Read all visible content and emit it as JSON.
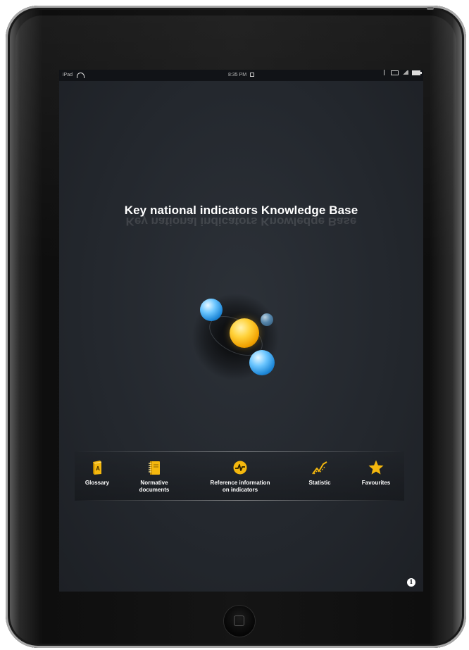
{
  "status_bar": {
    "carrier": "iPad",
    "time": "8:35 PM"
  },
  "app": {
    "title": "Key national indicators Knowledge Base"
  },
  "toolbar": {
    "items": [
      {
        "label": "Glossary",
        "icon": "glossary-book-icon"
      },
      {
        "label": "Normative\ndocuments",
        "icon": "notebook-icon"
      },
      {
        "label": "Reference information\non indicators",
        "icon": "reference-info-icon"
      },
      {
        "label": "Statistic",
        "icon": "statistic-chart-icon"
      },
      {
        "label": "Favourites",
        "icon": "star-icon"
      }
    ]
  },
  "info_button": {
    "glyph": "i"
  },
  "colors": {
    "accent": "#F5B80E",
    "background": "#23272D",
    "text": "#FFFFFF"
  }
}
